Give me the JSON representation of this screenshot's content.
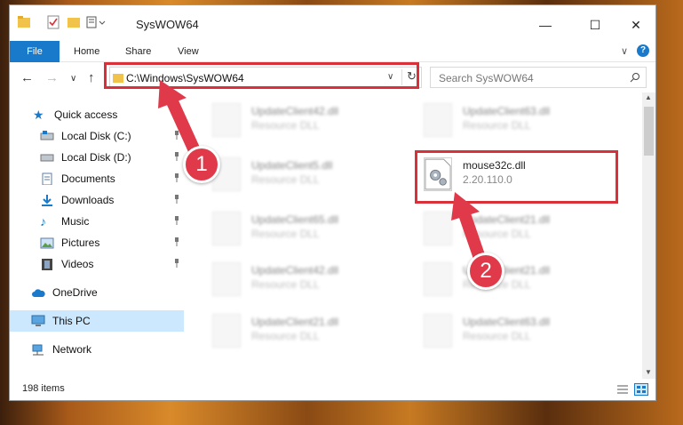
{
  "window": {
    "title": "SysWOW64"
  },
  "ribbon": {
    "tabs": [
      "File",
      "Home",
      "Share",
      "View"
    ]
  },
  "address": {
    "path": "C:\\Windows\\SysWOW64"
  },
  "search": {
    "placeholder": "Search SysWOW64"
  },
  "sidebar": {
    "items": [
      {
        "label": "Quick access"
      },
      {
        "label": "Local Disk (C:)"
      },
      {
        "label": "Local Disk (D:)"
      },
      {
        "label": "Documents"
      },
      {
        "label": "Downloads"
      },
      {
        "label": "Music"
      },
      {
        "label": "Pictures"
      },
      {
        "label": "Videos"
      },
      {
        "label": "OneDrive"
      },
      {
        "label": "This PC"
      },
      {
        "label": "Network"
      }
    ]
  },
  "files": [
    {
      "name": "UpdateClient42.dll",
      "sub": "Resource DLL"
    },
    {
      "name": "UpdateClient63.dll",
      "sub": "Resource DLL"
    },
    {
      "name": "UpdateClient5.dll",
      "sub": "Resource DLL"
    },
    {
      "name": "mouse32c.dll",
      "sub": "2.20.110.0"
    },
    {
      "name": "UpdateClient65.dll",
      "sub": "Resource DLL"
    },
    {
      "name": "UpdateClient21.dll",
      "sub": "Resource DLL"
    },
    {
      "name": "UpdateClient42.dll",
      "sub": "Resource DLL"
    },
    {
      "name": "UpdateClient21.dll",
      "sub": "Resource DLL"
    },
    {
      "name": "UpdateClient21.dll",
      "sub": "Resource DLL"
    },
    {
      "name": "UpdateClient63.dll",
      "sub": "Resource DLL"
    }
  ],
  "status": {
    "count": "198 items"
  },
  "annotations": {
    "step1": "1",
    "step2": "2",
    "color": "#e03a4a"
  }
}
